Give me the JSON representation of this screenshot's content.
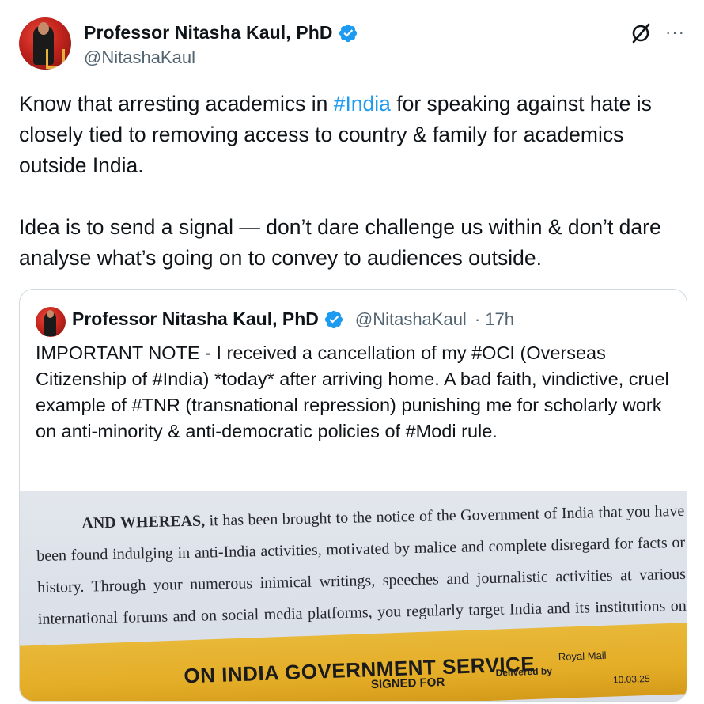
{
  "tweet": {
    "author": {
      "display_name": "Professor Nitasha Kaul, PhD",
      "handle": "@NitashaKaul",
      "verified_icon": "verified-badge-icon"
    },
    "text_before_hashtag": "Know that arresting academics in ",
    "hashtag": "#India",
    "text_after_hashtag": " for speaking against hate is closely tied to removing access to country & family for academics outside India.\n\nIdea is to send a signal — don’t dare challenge us within & don’t dare analyse what’s going on to convey to audiences outside.",
    "more_label": "···",
    "grok_icon": "grok-icon"
  },
  "quoted_tweet": {
    "author": {
      "display_name": "Professor Nitasha Kaul, PhD",
      "handle": "@NitashaKaul",
      "time": "· 17h"
    },
    "text": "IMPORTANT NOTE - I received a cancellation of my #OCI (Overseas Citizenship of #India) *today* after arriving home. A bad faith, vindictive, cruel example of #TNR (transnational repression) punishing me for scholarly work on anti-minority & anti-democratic policies of #Modi rule.",
    "image": {
      "doc_lead": "AND WHEREAS,",
      "doc_body": " it has been brought to the notice of the Government of India that you have been found indulging in anti-India activities, motivated by malice and complete disregard for facts or history. Through your numerous inimical writings, speeches and journalistic activities at various international forums and on social media platforms, you regularly target India and its institutions on the matters of India’s sovergnity. Through your",
      "envelope_text": "ON INDIA GOVERNMENT SERVICE",
      "envelope_sub": "SIGNED FOR",
      "envelope_mail": "Royal Mail",
      "envelope_delivered": "Delivered by",
      "envelope_date": "10.03.25"
    }
  },
  "colors": {
    "link": "#1d9bf0",
    "verified": "#1d9bf0",
    "secondary_text": "#536471",
    "envelope": "#e4ad27"
  }
}
